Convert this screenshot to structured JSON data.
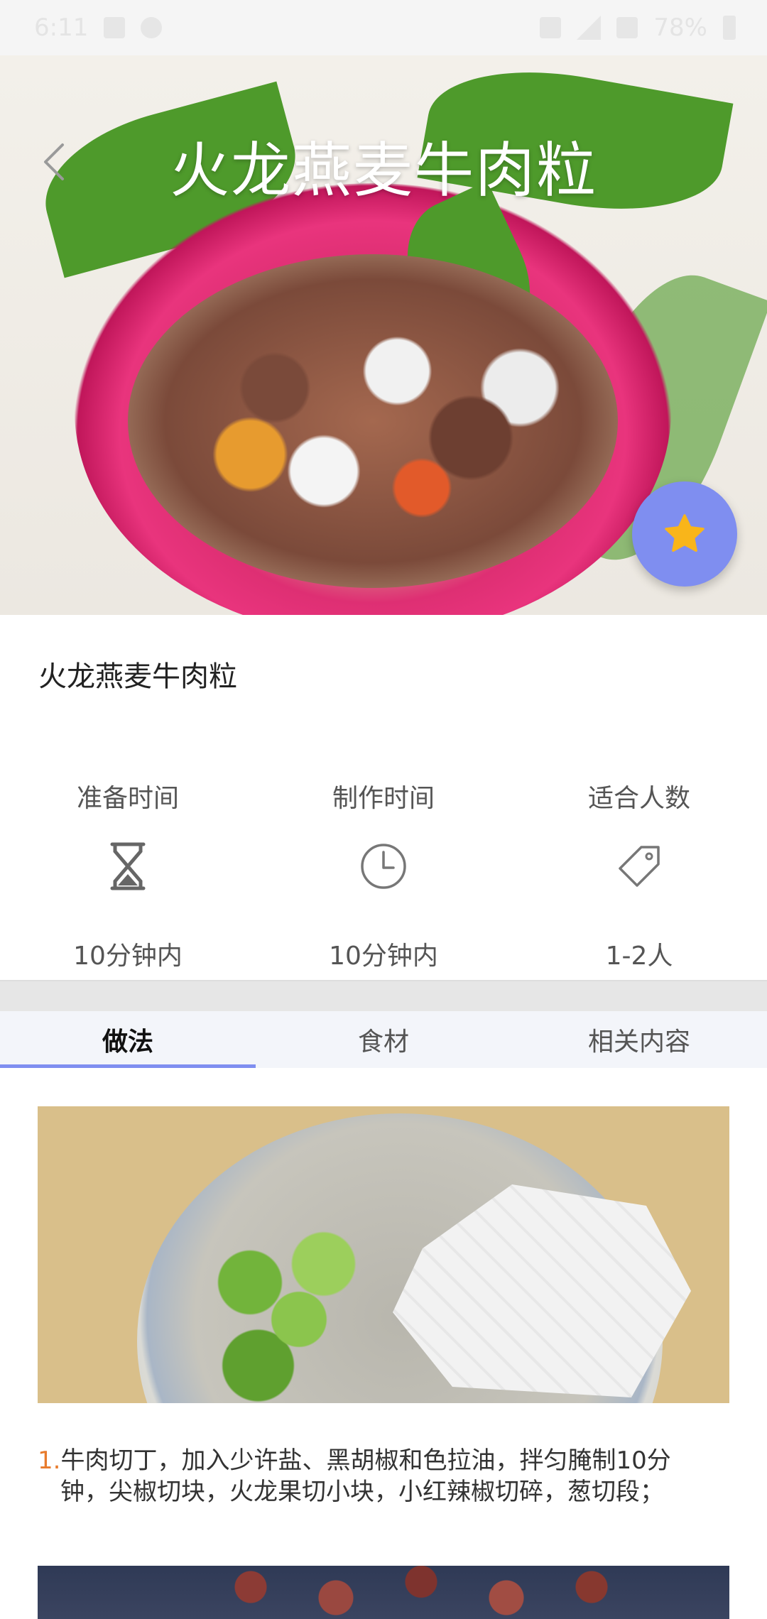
{
  "status_bar": {
    "time": "6:11",
    "battery": "78%"
  },
  "hero": {
    "title": "火龙燕麦牛肉粒"
  },
  "recipe": {
    "name": "火龙燕麦牛肉粒"
  },
  "stats": [
    {
      "label": "准备时间",
      "icon": "hourglass-icon",
      "value": "10分钟内"
    },
    {
      "label": "制作时间",
      "icon": "clock-icon",
      "value": "10分钟内"
    },
    {
      "label": "适合人数",
      "icon": "tag-icon",
      "value": "1-2人"
    }
  ],
  "tabs": [
    {
      "label": "做法",
      "active": true
    },
    {
      "label": "食材",
      "active": false
    },
    {
      "label": "相关内容",
      "active": false
    }
  ],
  "steps": [
    {
      "number": "1.",
      "text_line1": "牛肉切丁，加入少许盐、黑胡椒和色拉油，拌匀腌制10分",
      "text_line2": "钟，尖椒切块，火龙果切小块，小红辣椒切碎，葱切段；"
    }
  ],
  "colors": {
    "accent": "#7f8ef0",
    "star": "#f9b51a",
    "step_number": "#e87b2c"
  }
}
